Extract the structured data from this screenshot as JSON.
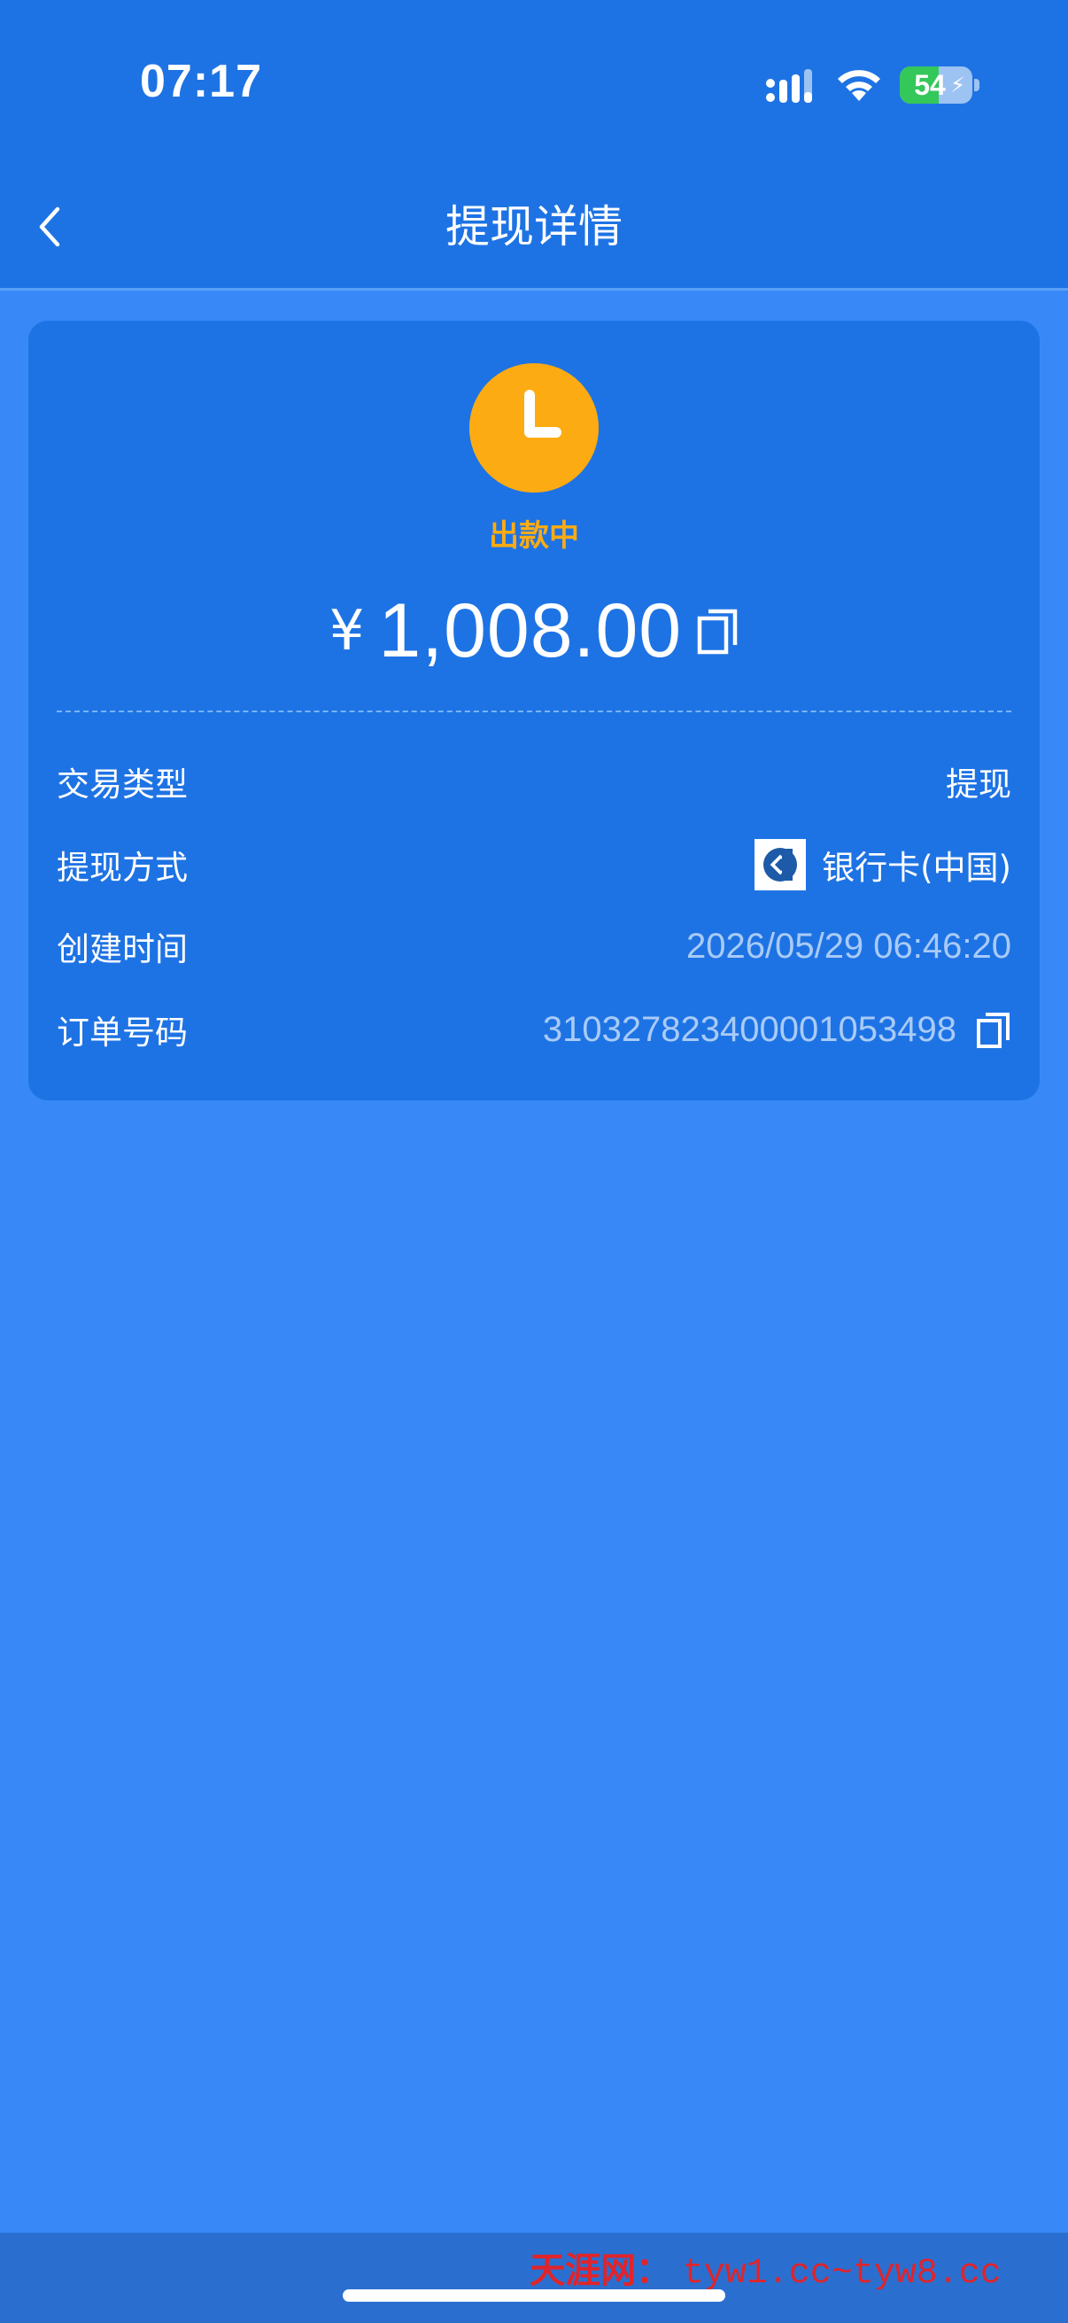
{
  "status_bar": {
    "time": "07:17",
    "battery_level": "54",
    "icons": [
      "signal-icon",
      "wifi-icon",
      "battery-charging-icon"
    ]
  },
  "nav": {
    "title": "提现详情",
    "back_icon": "chevron-left-icon"
  },
  "card": {
    "status_icon": "clock-icon",
    "status_label": "出款中",
    "currency_symbol": "¥",
    "amount": "1,008.00",
    "rows": [
      {
        "label": "交易类型",
        "value": "提现"
      },
      {
        "label": "提现方式",
        "value": "银行卡(中国)",
        "icon": "bank-logo-icon"
      },
      {
        "label": "创建时间",
        "value": "2026/05/29 06:46:20"
      },
      {
        "label": "订单号码",
        "value": "310327823400001053498",
        "action_icon": "copy-icon"
      }
    ]
  },
  "watermark": {
    "brand": "天涯网：",
    "links": "tyw1.cc~tyw8.cc"
  },
  "colors": {
    "page_bg": "#3889f7",
    "header_bg": "#1e73e4",
    "card_bg": "#1e73e4",
    "status_accent": "#fdab12",
    "muted_text": "#a9cbf7",
    "watermark": "#e0242a"
  }
}
